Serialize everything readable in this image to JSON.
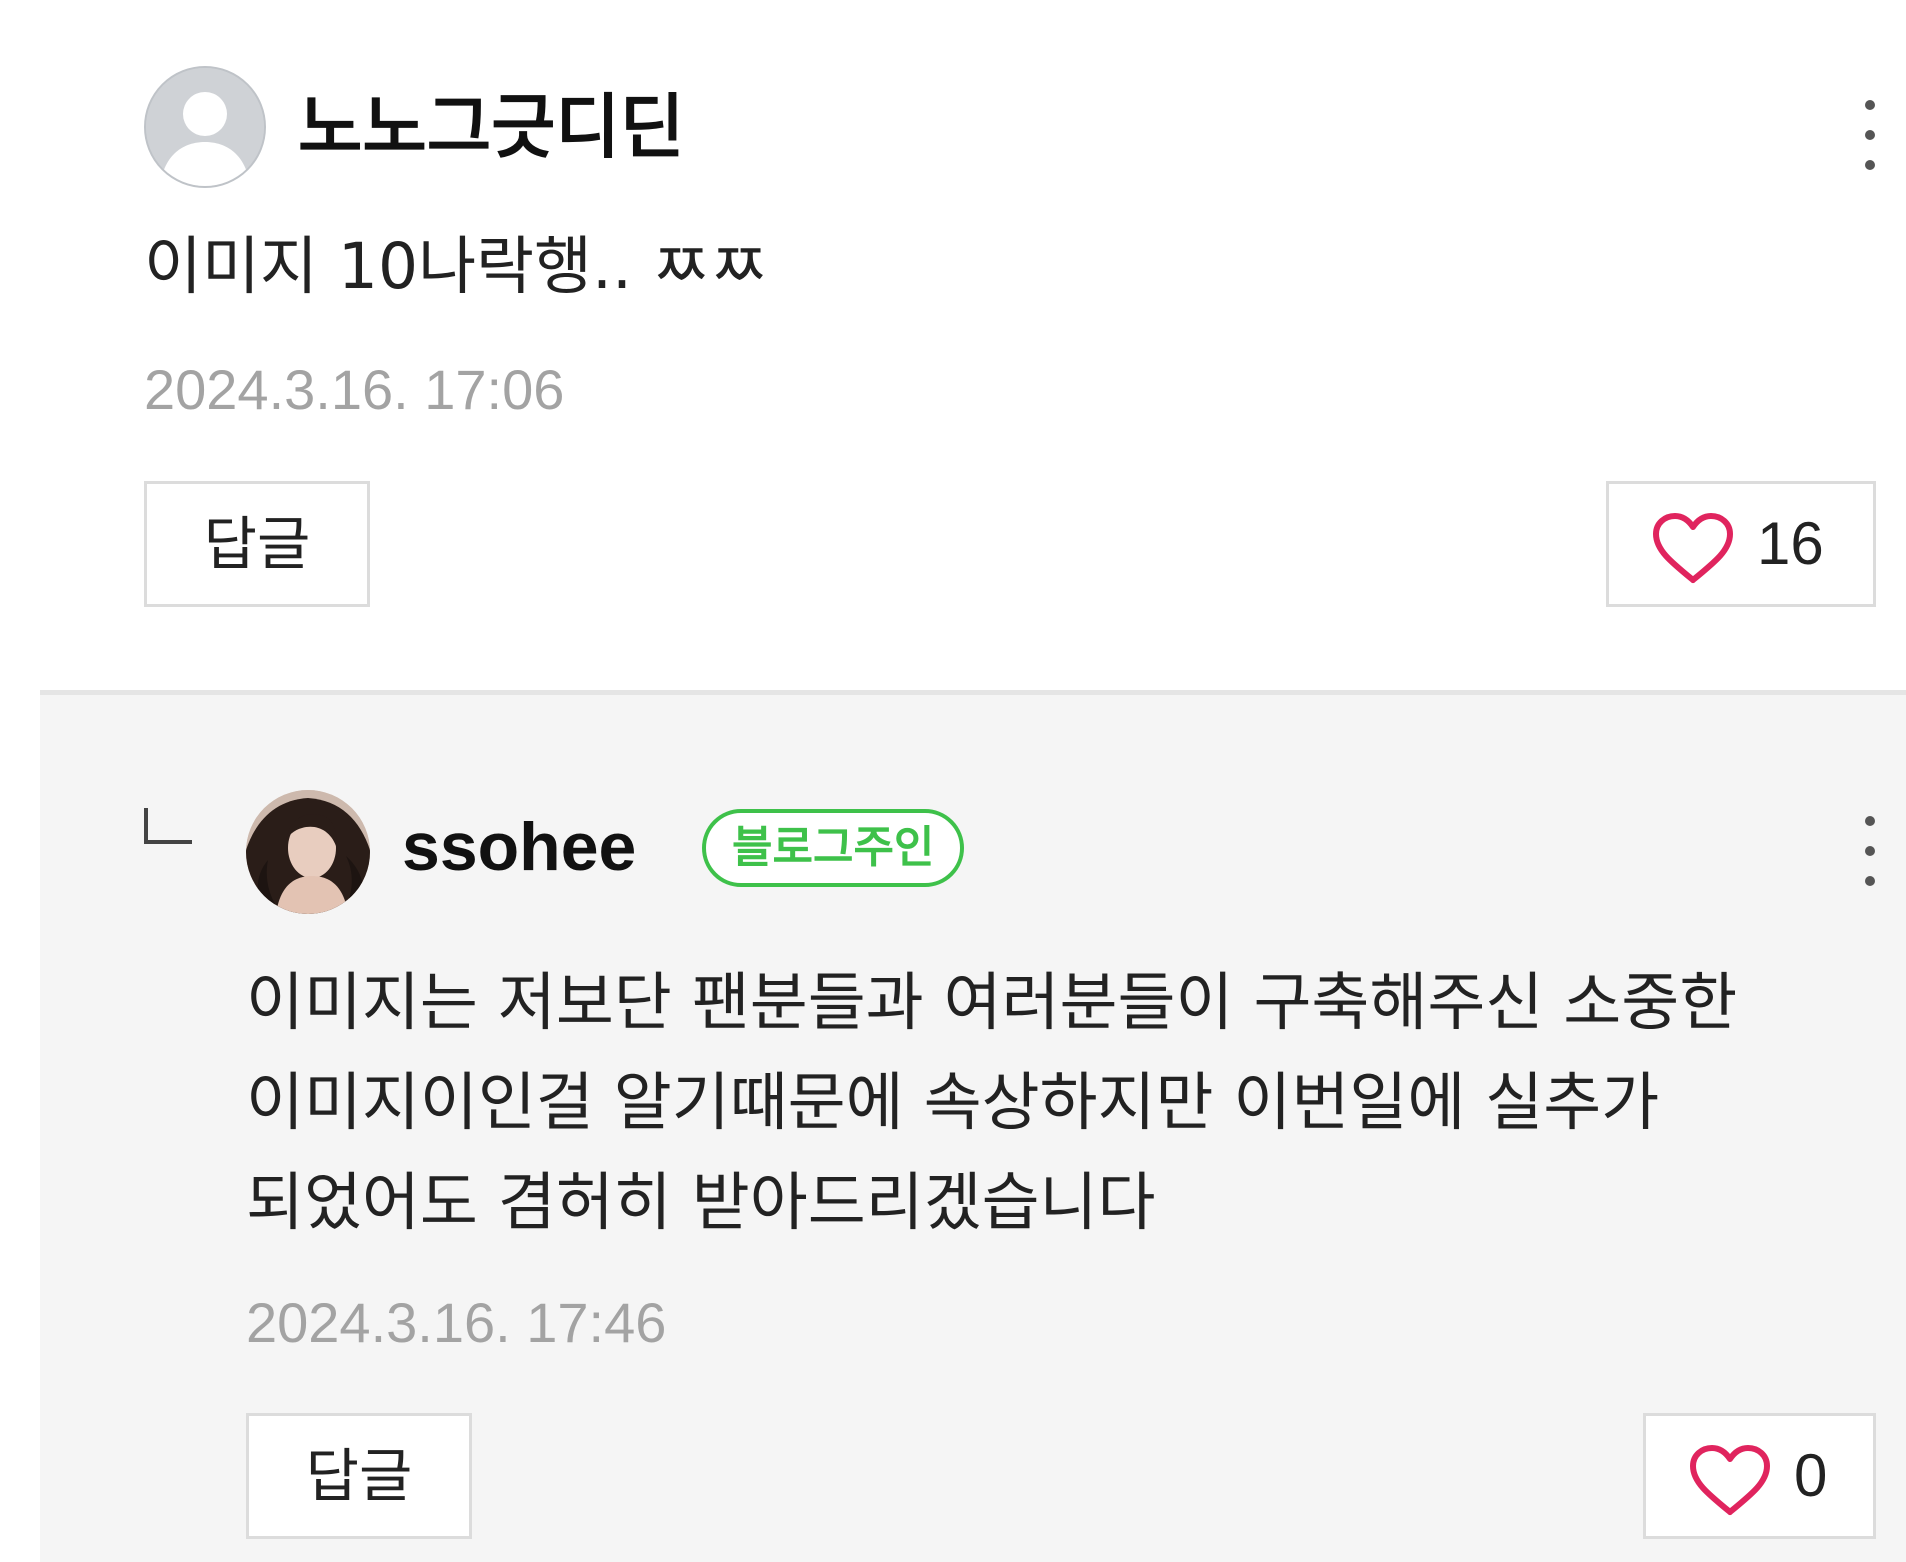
{
  "comment": {
    "nickname": "노노그긋디딘",
    "text": "이미지 10나락행.. ㅉㅉ",
    "date": "2024.3.16. 17:06",
    "reply_label": "답글",
    "like_count": "16",
    "avatar_icon": "default-profile-icon",
    "more_icon": "more-vertical-icon",
    "heart_icon": "heart-outline-icon",
    "heart_color": "#e0245e"
  },
  "reply": {
    "nickname": "ssohee",
    "badge": "블로그주인",
    "badge_color": "#3ec14a",
    "text": "이미지는 저보단 팬분들과 여러분들이 구축해주신 소중한 이미지이인걸 알기때문에 속상하지만 이번일에 실추가 되었어도 겸허히 받아드리겠습니다",
    "date": "2024.3.16. 17:46",
    "reply_label": "답글",
    "like_count": "0",
    "reply_marker_icon": "reply-corner-icon",
    "more_icon": "more-vertical-icon",
    "heart_icon": "heart-outline-icon"
  }
}
